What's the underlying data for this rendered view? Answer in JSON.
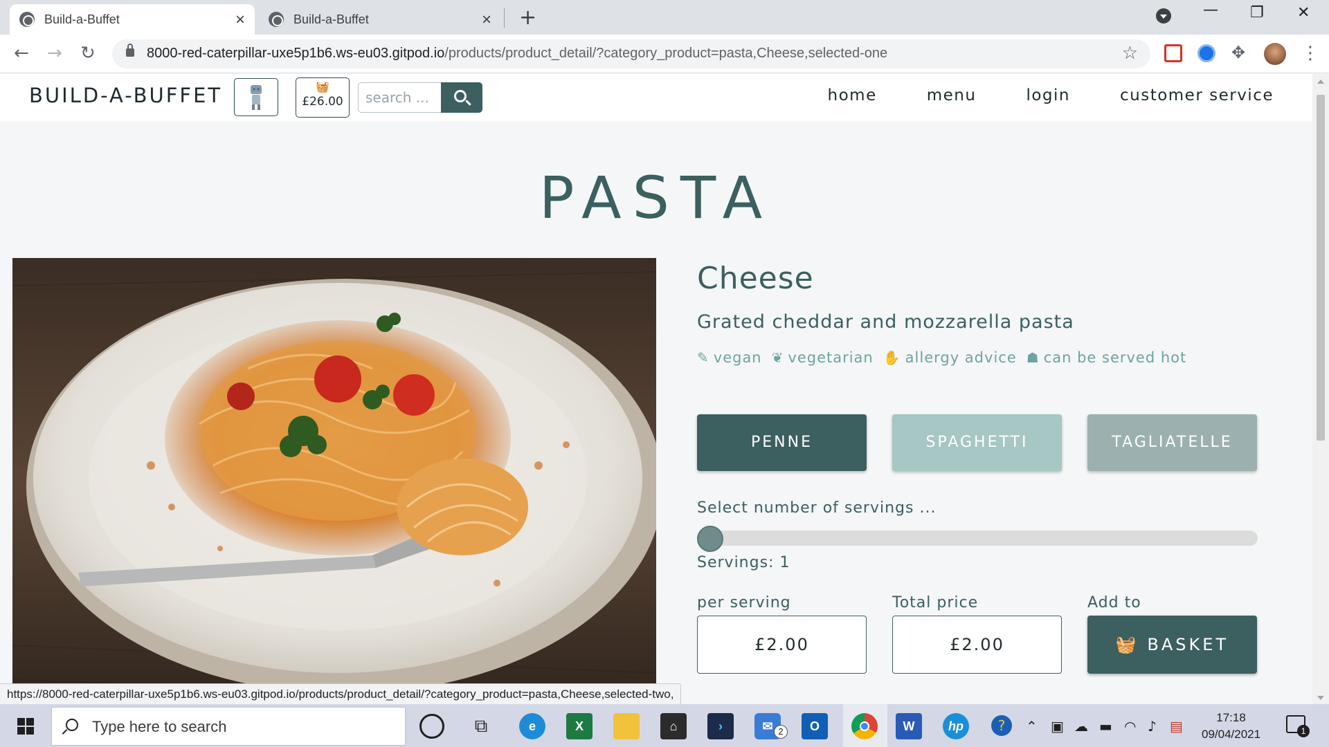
{
  "browser": {
    "tabs": [
      {
        "title": "Build-a-Buffet",
        "active": true
      },
      {
        "title": "Build-a-Buffet",
        "active": false
      }
    ],
    "url_host": "8000-red-caterpillar-uxe5p1b6.ws-eu03.gitpod.io",
    "url_path": "/products/product_detail/?category_product=pasta,Cheese,selected-one",
    "status_url": "https://8000-red-caterpillar-uxe5p1b6.ws-eu03.gitpod.io/products/product_detail/?category_product=pasta,Cheese,selected-two,"
  },
  "site": {
    "brand": "BUILD-A-BUFFET",
    "basket_total": "£26.00",
    "search_placeholder": "search ...",
    "menu": [
      "home",
      "menu",
      "login",
      "customer service"
    ]
  },
  "page": {
    "title": "PASTA"
  },
  "product": {
    "name": "Cheese",
    "description": "Grated cheddar and mozzarella pasta",
    "tags": [
      {
        "label": "vegan",
        "icon": "carrot-icon"
      },
      {
        "label": "vegetarian",
        "icon": "leaf-icon"
      },
      {
        "label": "allergy advice",
        "icon": "hand-icon"
      },
      {
        "label": "can be served hot",
        "icon": "mitten-icon"
      }
    ],
    "options": [
      {
        "label": "PENNE",
        "selected": true,
        "color": "#3c5f5f"
      },
      {
        "label": "SPAGHETTI",
        "selected": false,
        "color": "#a6c7c4"
      },
      {
        "label": "TAGLIATELLE",
        "selected": false,
        "color": "#9cb0b0"
      }
    ],
    "servings_prompt": "Select number of servings ...",
    "servings_text": "Servings: 1",
    "servings": 1,
    "per_serving_label": "per serving",
    "per_serving_price": "£2.00",
    "total_label": "Total price",
    "total_price": "£2.00",
    "add_label": "Add to",
    "basket_button": "BASKET"
  },
  "colors": {
    "accent": "#3c5f5f",
    "tag": "#6fa3a0"
  },
  "taskbar": {
    "search_placeholder": "Type here to search",
    "time": "17:18",
    "date": "09/04/2021",
    "mail_badge": "2",
    "notifications": "1"
  }
}
